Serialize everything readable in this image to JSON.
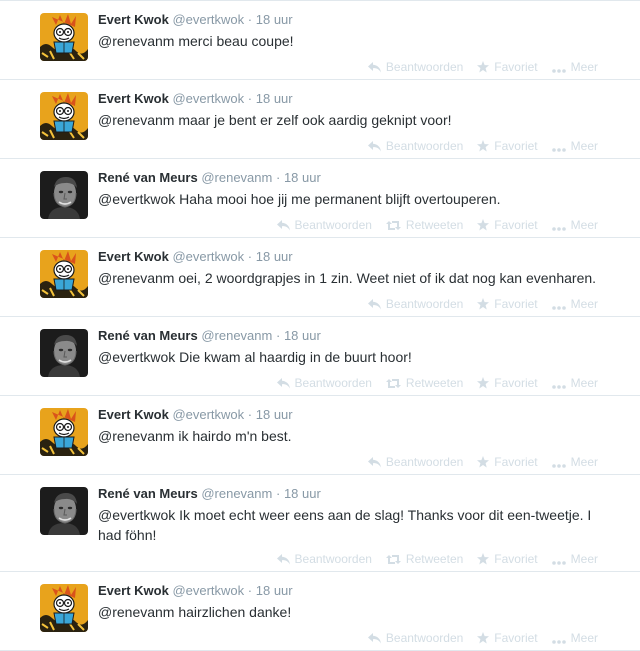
{
  "tweets": [
    {
      "avatar": "evert-avatar",
      "fullname": "Evert Kwok",
      "username": "@evertkwok",
      "time": "18 uur",
      "text": "@renevanm merci beau coupe!",
      "actions": [
        "Beantwoorden",
        "Favoriet",
        "Meer"
      ]
    },
    {
      "avatar": "evert-avatar",
      "fullname": "Evert Kwok",
      "username": "@evertkwok",
      "time": "18 uur",
      "text": "@renevanm maar je bent er zelf ook aardig geknipt voor!",
      "actions": [
        "Beantwoorden",
        "Favoriet",
        "Meer"
      ]
    },
    {
      "avatar": "rene-avatar",
      "fullname": "René van Meurs",
      "username": "@renevanm",
      "time": "18 uur",
      "text": "@evertkwok Haha mooi hoe jij me permanent blijft overtouperen.",
      "actions": [
        "Beantwoorden",
        "Retweeten",
        "Favoriet",
        "Meer"
      ]
    },
    {
      "avatar": "evert-avatar",
      "fullname": "Evert Kwok",
      "username": "@evertkwok",
      "time": "18 uur",
      "text": "@renevanm oei, 2 woordgrapjes in 1 zin. Weet niet of ik dat nog kan evenharen.",
      "actions": [
        "Beantwoorden",
        "Favoriet",
        "Meer"
      ]
    },
    {
      "avatar": "rene-avatar",
      "fullname": "René van Meurs",
      "username": "@renevanm",
      "time": "18 uur",
      "text": "@evertkwok Die kwam al haardig in de buurt hoor!",
      "actions": [
        "Beantwoorden",
        "Retweeten",
        "Favoriet",
        "Meer"
      ]
    },
    {
      "avatar": "evert-avatar",
      "fullname": "Evert Kwok",
      "username": "@evertkwok",
      "time": "18 uur",
      "text": "@renevanm ik hairdo m'n best.",
      "actions": [
        "Beantwoorden",
        "Favoriet",
        "Meer"
      ]
    },
    {
      "avatar": "rene-avatar",
      "fullname": "René van Meurs",
      "username": "@renevanm",
      "time": "18 uur",
      "text": "@evertkwok Ik moet echt weer eens aan de slag! Thanks voor dit een-tweetje. I had föhn!",
      "actions": [
        "Beantwoorden",
        "Retweeten",
        "Favoriet",
        "Meer"
      ]
    },
    {
      "avatar": "evert-avatar",
      "fullname": "Evert Kwok",
      "username": "@evertkwok",
      "time": "18 uur",
      "text": "@renevanm hairzlichen danke!",
      "actions": [
        "Beantwoorden",
        "Favoriet",
        "Meer"
      ]
    }
  ],
  "separator": "·",
  "colors": {
    "border": "#e1e8ed",
    "name": "#292f33",
    "meta": "#8899a6",
    "action": "#d3dde4"
  }
}
